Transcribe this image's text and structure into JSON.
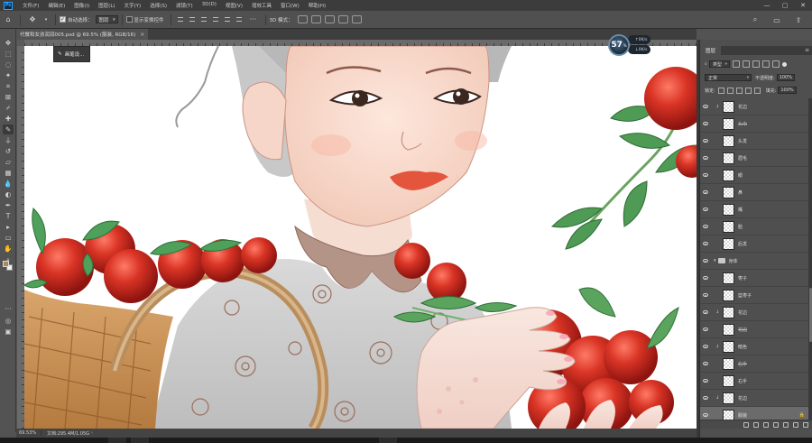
{
  "app": {
    "logo": "Ps",
    "menus": [
      "文件(F)",
      "编辑(E)",
      "图像(I)",
      "图层(L)",
      "文字(Y)",
      "选择(S)",
      "滤镜(T)",
      "3D(D)",
      "视图(V)",
      "增效工具",
      "窗口(W)",
      "帮助(H)"
    ],
    "window_controls": [
      "—",
      "▢",
      "✕"
    ]
  },
  "options": {
    "auto_select_label": "自动选择：",
    "auto_select_checked": true,
    "target_value": "图层",
    "show_transform_label": "显示变换控件",
    "show_transform_checked": false,
    "mode_3d_label": "3D 模式："
  },
  "document": {
    "tab_title": "代餐和女孩润润005.psd @ 69.5% (服装, RGB/16)",
    "close_glyph": "×"
  },
  "tooltip": {
    "text": "画笔设..."
  },
  "hud": {
    "zoom_value": "57",
    "zoom_unit": "%",
    "upload_speed": "0K/s",
    "download_speed": "0K/s",
    "up_arrow": "↑",
    "down_arrow": "↓"
  },
  "statusbar": {
    "zoom": "69.53%",
    "doc_info": "文档:295.4M/1.05G",
    "arrow": "›"
  },
  "colors": {
    "foreground": "#a88a5f",
    "background": "#f1f1f1",
    "accent": "#31a8ff"
  },
  "tools": [
    "move-icon",
    "marquee-icon",
    "lasso-icon",
    "magic-wand-icon",
    "crop-icon",
    "frame-icon",
    "eyedropper-icon",
    "healing-icon",
    "brush-icon",
    "stamp-icon",
    "history-brush-icon",
    "eraser-icon",
    "gradient-icon",
    "blur-icon",
    "dodge-icon",
    "pen-icon",
    "type-icon",
    "path-select-icon",
    "shape-icon",
    "hand-icon",
    "zoom-icon",
    "more-icon"
  ],
  "layers_panel": {
    "tab": "图层",
    "filter_kind": "类型",
    "blend_mode": "正常",
    "opacity_label": "不透明度:",
    "opacity_value": "100%",
    "lock_label": "锁定:",
    "fill_label": "填充:",
    "fill_value": "100%",
    "layers": [
      {
        "name": "花边",
        "clipped": true,
        "folder": false,
        "selected": false,
        "strike": false,
        "locked": false
      },
      {
        "name": "头巾",
        "clipped": false,
        "folder": false,
        "selected": false,
        "strike": true,
        "locked": false
      },
      {
        "name": "头发",
        "clipped": false,
        "folder": false,
        "selected": false,
        "strike": false,
        "locked": false
      },
      {
        "name": "眉毛",
        "clipped": false,
        "folder": false,
        "selected": false,
        "strike": false,
        "locked": false
      },
      {
        "name": "眼",
        "clipped": false,
        "folder": false,
        "selected": false,
        "strike": false,
        "locked": false
      },
      {
        "name": "鼻",
        "clipped": false,
        "folder": false,
        "selected": false,
        "strike": false,
        "locked": false
      },
      {
        "name": "嘴",
        "clipped": false,
        "folder": false,
        "selected": false,
        "strike": false,
        "locked": false
      },
      {
        "name": "脸",
        "clipped": false,
        "folder": false,
        "selected": false,
        "strike": false,
        "locked": false
      },
      {
        "name": "后发",
        "clipped": false,
        "folder": false,
        "selected": false,
        "strike": false,
        "locked": false
      },
      {
        "name": "身体",
        "clipped": false,
        "folder": true,
        "selected": false,
        "strike": false,
        "locked": false
      },
      {
        "name": "枣子",
        "clipped": false,
        "folder": false,
        "selected": false,
        "strike": false,
        "locked": false
      },
      {
        "name": "篮枣子",
        "clipped": false,
        "folder": false,
        "selected": false,
        "strike": false,
        "locked": false
      },
      {
        "name": "花边",
        "clipped": true,
        "folder": false,
        "selected": false,
        "strike": false,
        "locked": false
      },
      {
        "name": "花边",
        "clipped": false,
        "folder": false,
        "selected": false,
        "strike": true,
        "locked": false
      },
      {
        "name": "暗色",
        "clipped": true,
        "folder": false,
        "selected": false,
        "strike": false,
        "locked": false
      },
      {
        "name": "右手",
        "clipped": false,
        "folder": false,
        "selected": false,
        "strike": true,
        "locked": false
      },
      {
        "name": "右手",
        "clipped": false,
        "folder": false,
        "selected": false,
        "strike": false,
        "locked": false
      },
      {
        "name": "花边",
        "clipped": true,
        "folder": false,
        "selected": false,
        "strike": false,
        "locked": false
      },
      {
        "name": "服装",
        "clipped": false,
        "folder": false,
        "selected": true,
        "strike": false,
        "locked": true
      }
    ],
    "lock_glyph": "🔒",
    "caret_glyph": "▾",
    "clip_glyph": "↓"
  }
}
